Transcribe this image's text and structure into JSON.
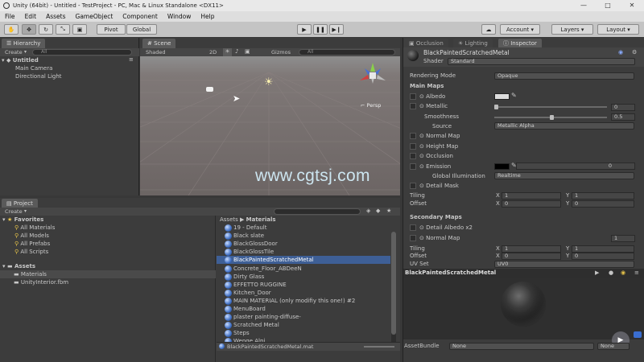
{
  "window": {
    "title": "Unity (64bit) - Untitled - TestProject - PC, Mac & Linux Standalone <DX11>"
  },
  "menu": [
    "File",
    "Edit",
    "Assets",
    "GameObject",
    "Component",
    "Window",
    "Help"
  ],
  "toolbar": {
    "pivot": "Pivot",
    "global": "Global",
    "account": "Account",
    "layers": "Layers",
    "layout": "Layout"
  },
  "hierarchy": {
    "tab": "Hierarchy",
    "create": "Create",
    "search": "All",
    "scene": "Untitled",
    "items": [
      "Main Camera",
      "Directional Light"
    ]
  },
  "scene": {
    "tab": "Scene",
    "shaded": "Shaded",
    "mode2d": "2D",
    "gizmos": "Gizmos",
    "search": "All",
    "persp": "Persp"
  },
  "watermark": "www.cgtsj.com",
  "project": {
    "tab": "Project",
    "create": "Create",
    "favorites_label": "Favorites",
    "favorites": [
      "All Materials",
      "All Models",
      "All Prefabs",
      "All Scripts"
    ],
    "assets_label": "Assets",
    "folders": [
      "Materials",
      "UnityInterior.fbm"
    ],
    "breadcrumb_root": "Assets",
    "breadcrumb_sep": "▶",
    "breadcrumb_leaf": "Materials",
    "files": [
      "19 - Default",
      "Black slate",
      "BlackGlossDoor",
      "BlackGlossTile",
      "BlackPaintedScratchedMetal",
      "Concrete_Floor_ABDeeN",
      "Dirty Glass",
      "EFFETTO RUGGINE",
      "Kitchen_Door",
      "MAIN MATERIAL (only modifiy this one!) #2",
      "MenuBoard",
      "plaster painting-diffuse-",
      "Scratched Metal",
      "Steps",
      "Wenge Alpi"
    ],
    "selected_index": 4,
    "footer": "BlackPaintedScratchedMetal.mat"
  },
  "inspector_tabs": [
    "Occlusion",
    "Lighting",
    "Inspector"
  ],
  "inspector": {
    "material_name": "BlackPaintedScratchedMetal",
    "shader_label": "Shader",
    "shader_value": "Standard",
    "rendering_mode_label": "Rendering Mode",
    "rendering_mode_value": "Opaque",
    "main_maps": "Main Maps",
    "albedo": "Albedo",
    "metallic": "Metallic",
    "metallic_value": "0",
    "metallic_level": 0,
    "smoothness": "Smoothness",
    "smoothness_value": "0.5",
    "smoothness_level": 0.5,
    "source": "Source",
    "source_value": "Metallic Alpha",
    "normal_map": "Normal Map",
    "height_map": "Height Map",
    "occlusion": "Occlusion",
    "emission": "Emission",
    "emission_value": "0",
    "global_illumination": "Global Illumination",
    "gi_value": "Realtime",
    "detail_mask": "Detail Mask",
    "tiling": "Tiling",
    "offset": "Offset",
    "tiling_x": "1",
    "tiling_y": "1",
    "offset_x": "0",
    "offset_y": "0",
    "x_label": "X",
    "y_label": "Y",
    "secondary_maps": "Secondary Maps",
    "detail_albedo": "Detail Albedo x2",
    "normal_map2": "Normal Map",
    "normal_map2_value": "1",
    "tiling2_x": "1",
    "tiling2_y": "1",
    "offset2_x": "0",
    "offset2_y": "0",
    "uv_set": "UV Set",
    "uv_value": "UV0",
    "preview_title": "BlackPaintedScratchedMetal",
    "assetbundle_label": "AssetBundle",
    "assetbundle_value": "None",
    "assetbundle_variant": "None"
  },
  "colors": {
    "accent": "#3e5f96",
    "background": "#383838",
    "panel": "#3c3c3c"
  }
}
